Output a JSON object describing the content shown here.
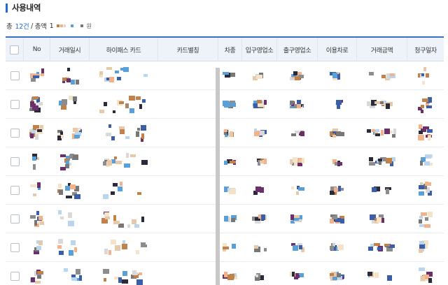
{
  "section": {
    "title": "사용내역"
  },
  "summary": {
    "total_label": "총",
    "total_count": "12건",
    "separator": " / ",
    "amount_label": "총액",
    "amount_value_lead": "1",
    "amount_unit": "원"
  },
  "table": {
    "columns": [
      "No",
      "거래일시",
      "하이패스 카드",
      "카드별칭",
      "차종",
      "입구영업소",
      "출구영업소",
      "이용차로",
      "거래금액",
      "청구일자"
    ],
    "row_count": 8
  },
  "colors": {
    "accent": "#1e6bd6",
    "header_bg": "#eef3fa",
    "header_border": "#3b6fbf"
  }
}
